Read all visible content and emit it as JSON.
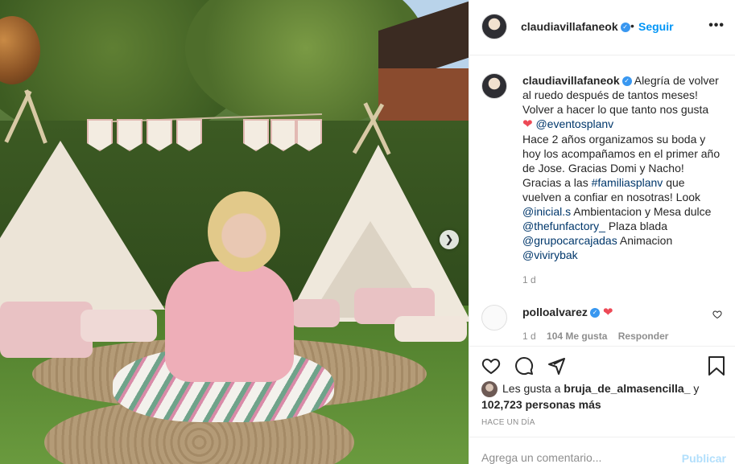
{
  "post": {
    "username": "claudiavillafaneok",
    "follow_label": "Seguir",
    "separator": "•",
    "more_label": "•••",
    "caption_text": "Alegría de volver al ruedo después de tantos meses! Volver a hacer lo que tanto nos gusta",
    "caption_mention_1": "@eventosplanv",
    "caption_text_2": "Hace 2 años organizamos su boda y hoy los acompañamos en el primer año de Jose. Gracias Domi y Nacho! Gracias a las",
    "caption_hashtag": "#familiasplanv",
    "caption_text_3": "que vuelven a confiar en nosotras! Look",
    "caption_mention_2": "@inicial.s",
    "caption_text_4": "Ambientacion y Mesa dulce",
    "caption_mention_3": "@thefunfactory_",
    "caption_text_5": "Plaza blada",
    "caption_mention_4": "@grupocarcajadas",
    "caption_text_6": "Animacion",
    "caption_mention_5": "@vivirybak",
    "caption_time": "1 d",
    "heart_emoji": "❤"
  },
  "comment": {
    "username": "polloalvarez",
    "text": "❤",
    "time": "1 d",
    "likes": "104 Me gusta",
    "reply_label": "Responder"
  },
  "likes": {
    "prefix": "Les gusta a",
    "user": "bruja_de_almasencilla_",
    "conjunction": "y",
    "count": "102,723 personas más"
  },
  "posted": "HACE UN DÍA",
  "comment_box": {
    "placeholder": "Agrega un comentario...",
    "publish_label": "Publicar"
  },
  "icons": {
    "verified": "✓",
    "next": "❯"
  },
  "colors": {
    "link": "#00376b",
    "follow": "#0095f6",
    "verified": "#3897f0",
    "heart": "#ed4956"
  }
}
